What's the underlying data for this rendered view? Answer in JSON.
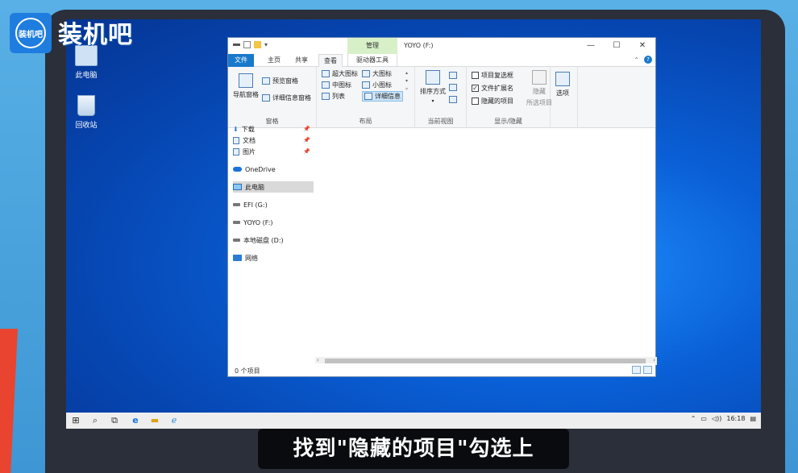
{
  "brand": {
    "logo_text": "装机吧",
    "badge_text": "装机吧"
  },
  "desktop": {
    "icons": [
      {
        "label": "此电脑"
      },
      {
        "label": "回收站"
      }
    ]
  },
  "explorer": {
    "window_title": "YOYO (F:)",
    "manage_tab": "管理",
    "controls": {
      "minimize": "—",
      "maximize": "☐",
      "close": "✕"
    },
    "tabs": [
      "文件",
      "主页",
      "共享",
      "查看",
      "驱动器工具"
    ],
    "ribbon": {
      "panes": {
        "nav_pane": "导航窗格",
        "preview_pane": "预览窗格",
        "details_pane": "详细信息窗格",
        "label": "窗格"
      },
      "layout": {
        "items": [
          "超大图标",
          "大图标",
          "中图标",
          "小图标",
          "列表",
          "详细信息"
        ],
        "label": "布局"
      },
      "current_view": {
        "sort_by": "排序方式",
        "label": "当前视图"
      },
      "show_hide": {
        "item_checkboxes": "项目复选框",
        "file_extensions": "文件扩展名",
        "hidden_items": "隐藏的项目",
        "hide_label": "隐藏",
        "selected_items": "所选项目",
        "label": "显示/隐藏",
        "item_checkboxes_checked": false,
        "file_extensions_checked": true,
        "hidden_items_checked": false
      },
      "options": "选项"
    },
    "nav": [
      "下载",
      "文档",
      "图片",
      "OneDrive",
      "此电脑",
      "EFI (G:)",
      "YOYO (F:)",
      "本地磁盘 (D:)",
      "网络"
    ],
    "status": "0 个项目"
  },
  "taskbar": {
    "time": "16:18"
  },
  "subtitle": "找到\"隐藏的项目\"勾选上"
}
